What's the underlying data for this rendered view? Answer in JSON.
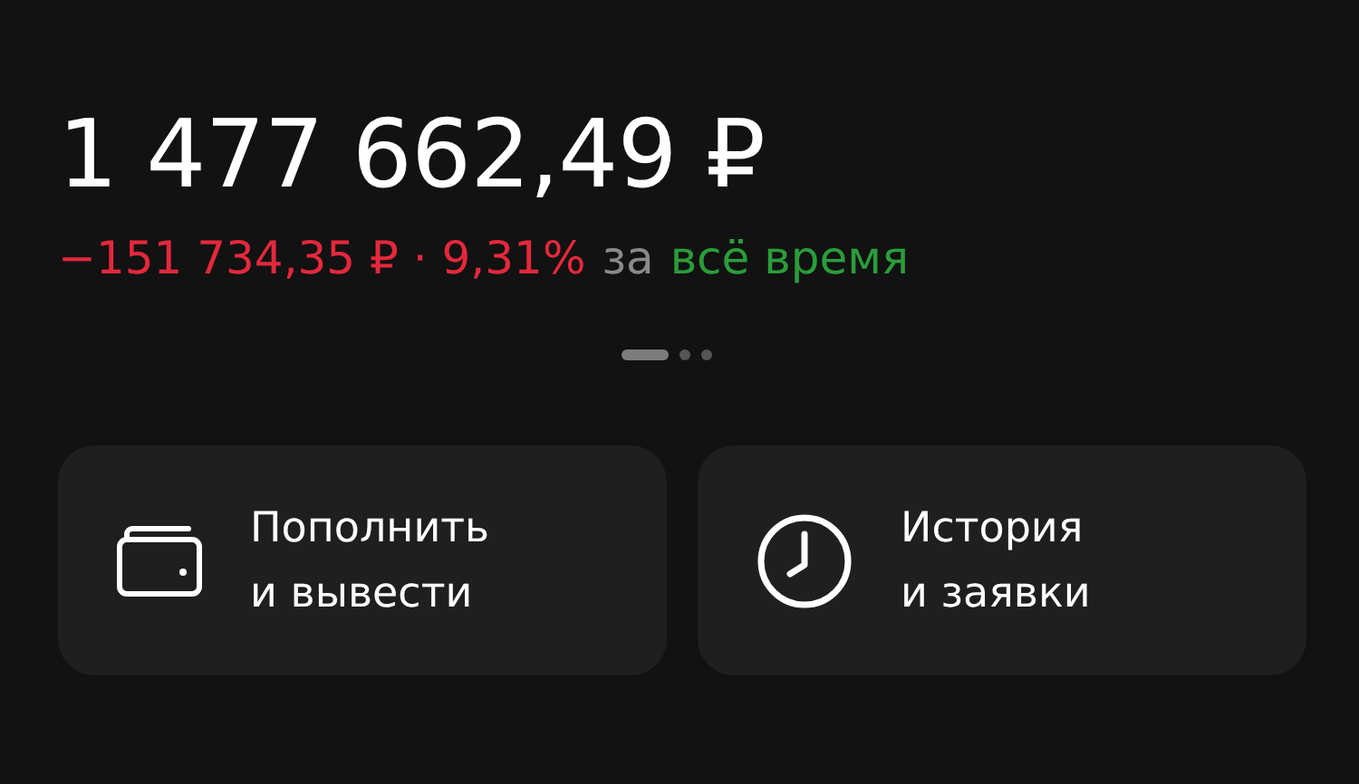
{
  "balance": "1 477 662,49 ₽",
  "change": {
    "text": "−151 734,35 ₽ · 9,31%",
    "negative": true,
    "connector": "за",
    "period": "всё время"
  },
  "pager": [
    {
      "selected": true
    },
    {
      "selected": false
    },
    {
      "selected": false
    }
  ],
  "actions": [
    {
      "kind": "wallet",
      "lines": [
        "Пополнить",
        "и вывести"
      ]
    },
    {
      "kind": "clock",
      "lines": [
        "История",
        "и заявки"
      ]
    }
  ]
}
